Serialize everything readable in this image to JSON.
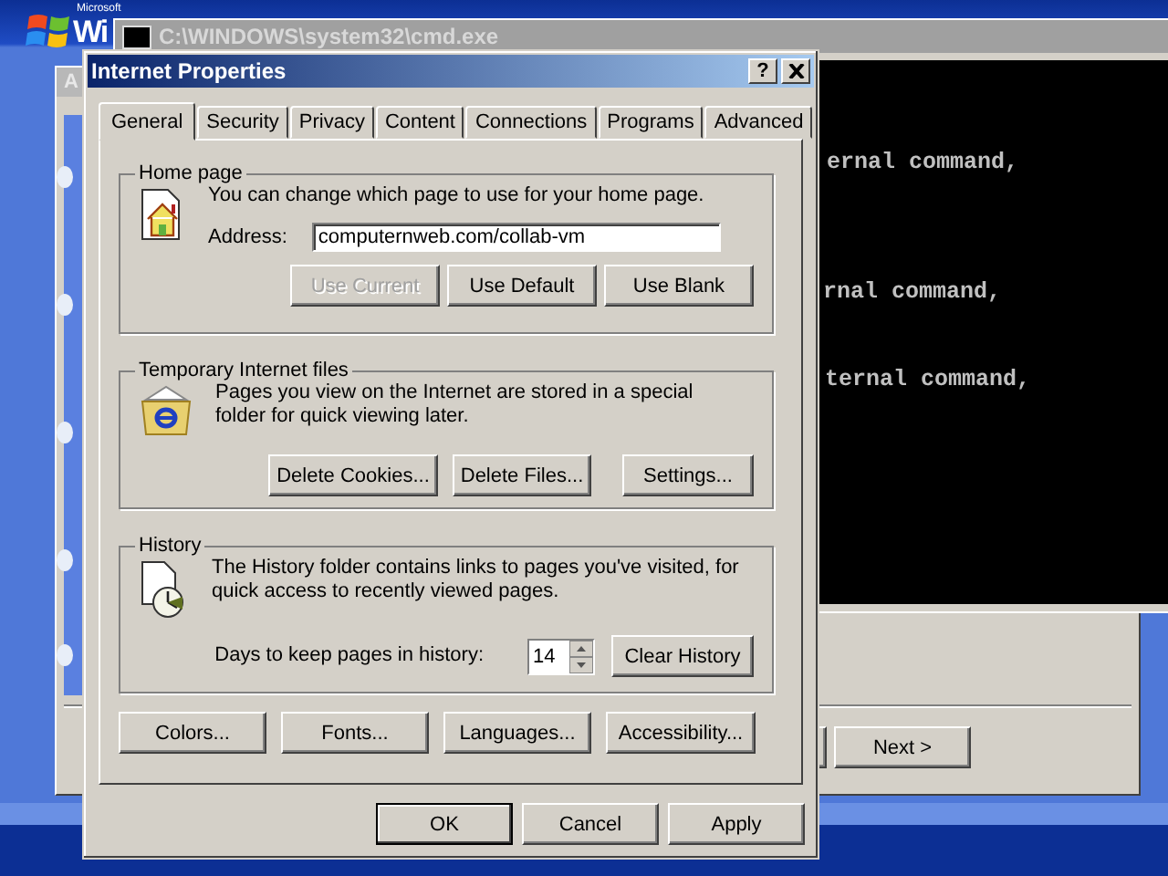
{
  "desktop": {
    "logo_small": "Microsoft",
    "logo": "Wi"
  },
  "wizard": {
    "title": "A",
    "buttons": [
      {
        "label": "Next >"
      }
    ]
  },
  "console": {
    "title": "C:\\WINDOWS\\system32\\cmd.exe",
    "lines": [
      "ernal command,",
      "rnal command,",
      "ternal command,"
    ]
  },
  "dialog": {
    "title": "Internet Properties",
    "help": "?",
    "tabs": [
      {
        "label": "General",
        "selected": true
      },
      {
        "label": "Security",
        "selected": false
      },
      {
        "label": "Privacy",
        "selected": false
      },
      {
        "label": "Content",
        "selected": false
      },
      {
        "label": "Connections",
        "selected": false
      },
      {
        "label": "Programs",
        "selected": false
      },
      {
        "label": "Advanced",
        "selected": false
      }
    ],
    "home_page": {
      "label": "Home page",
      "text": "You can change which page to use for your home page.",
      "address_label": "Address:",
      "address": "computernweb.com/collab-vm",
      "buttons": [
        {
          "label": "Use Current",
          "disabled": true
        },
        {
          "label": "Use Default",
          "disabled": false
        },
        {
          "label": "Use Blank",
          "disabled": false
        }
      ]
    },
    "temporary_files": {
      "label": "Temporary Internet files",
      "text": "Pages you view on the Internet are stored in a special folder for quick viewing later.",
      "buttons": [
        "Delete Cookies...",
        "Delete Files...",
        "Settings..."
      ]
    },
    "history": {
      "label": "History",
      "text": "The History folder contains links to pages you've visited, for quick access to recently viewed pages.",
      "days_label": "Days to keep pages in history:",
      "days": "14",
      "button": "Clear History"
    },
    "bottom_buttons": [
      "Colors...",
      "Fonts...",
      "Languages...",
      "Accessibility..."
    ],
    "footer_buttons": [
      {
        "label": "OK",
        "default": true
      },
      {
        "label": "Cancel",
        "default": false
      },
      {
        "label": "Apply",
        "default": false
      }
    ]
  }
}
